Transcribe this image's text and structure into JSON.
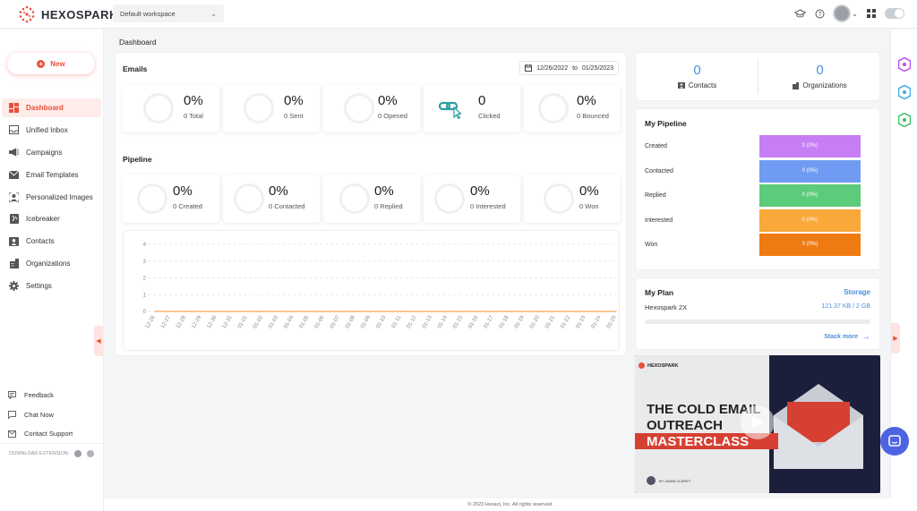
{
  "app": {
    "name": "HEXOSPARK",
    "workspace": "Default workspace"
  },
  "sidebar": {
    "new_label": "New",
    "items": [
      {
        "label": "Dashboard",
        "icon": "dashboard-icon",
        "active": true
      },
      {
        "label": "Unified Inbox",
        "icon": "inbox-icon"
      },
      {
        "label": "Campaigns",
        "icon": "megaphone-icon"
      },
      {
        "label": "Email Templates",
        "icon": "email-icon"
      },
      {
        "label": "Personalized Images",
        "icon": "image-icon"
      },
      {
        "label": "Icebreaker",
        "icon": "icebreaker-icon"
      },
      {
        "label": "Contacts",
        "icon": "contact-icon"
      },
      {
        "label": "Organizations",
        "icon": "building-icon"
      },
      {
        "label": "Settings",
        "icon": "gear-icon"
      }
    ],
    "bottom": [
      {
        "label": "Feedback",
        "icon": "feedback-icon"
      },
      {
        "label": "Chat Now",
        "icon": "chat-icon"
      },
      {
        "label": "Contact Support",
        "icon": "support-icon"
      }
    ],
    "download_label": "DOWNLOAD EXTENSION:"
  },
  "page_title": "Dashboard",
  "emails": {
    "title": "Emails",
    "date_from": "12/26/2022",
    "date_to_word": "to",
    "date_to": "01/25/2023",
    "stats": [
      {
        "value": "0%",
        "label": "0 Total"
      },
      {
        "value": "0%",
        "label": "0 Sent"
      },
      {
        "value": "0%",
        "label": "0 Opened"
      },
      {
        "value": "0",
        "label": "Clicked"
      },
      {
        "value": "0%",
        "label": "0 Bounced"
      }
    ]
  },
  "pipeline": {
    "title": "Pipeline",
    "stats": [
      {
        "value": "0%",
        "label": "0 Created"
      },
      {
        "value": "0%",
        "label": "0 Contacted"
      },
      {
        "value": "0%",
        "label": "0 Replied"
      },
      {
        "value": "0%",
        "label": "0 Interested"
      },
      {
        "value": "0%",
        "label": "0 Won"
      }
    ]
  },
  "chart_data": {
    "type": "line",
    "x": [
      "12-26",
      "12-27",
      "12-28",
      "12-29",
      "12-30",
      "12-31",
      "01-01",
      "01-02",
      "01-03",
      "01-04",
      "01-05",
      "01-06",
      "01-07",
      "01-08",
      "01-09",
      "01-10",
      "01-11",
      "01-12",
      "01-13",
      "01-14",
      "01-15",
      "01-16",
      "01-17",
      "01-18",
      "01-19",
      "01-20",
      "01-21",
      "01-22",
      "01-23",
      "01-24",
      "01-25"
    ],
    "series": [
      {
        "values": [
          0,
          0,
          0,
          0,
          0,
          0,
          0,
          0,
          0,
          0,
          0,
          0,
          0,
          0,
          0,
          0,
          0,
          0,
          0,
          0,
          0,
          0,
          0,
          0,
          0,
          0,
          0,
          0,
          0,
          0,
          0
        ]
      }
    ],
    "yticks": [
      "0",
      "1",
      "2",
      "3",
      "4"
    ],
    "ylim": [
      0,
      4
    ],
    "grid": true,
    "line_color": "#f5a34b"
  },
  "counts": {
    "contacts": {
      "value": "0",
      "label": "Contacts"
    },
    "organizations": {
      "value": "0",
      "label": "Organizations"
    }
  },
  "my_pipeline": {
    "title": "My Pipeline",
    "rows": [
      {
        "label": "Created",
        "value": "0 (0%)",
        "color": "#c77ef5"
      },
      {
        "label": "Contacted",
        "value": "0 (0%)",
        "color": "#6f9cf2"
      },
      {
        "label": "Replied",
        "value": "0 (0%)",
        "color": "#5ccb7a"
      },
      {
        "label": "Interested",
        "value": "0 (0%)",
        "color": "#f9a83a"
      },
      {
        "label": "Won",
        "value": "0 (0%)",
        "color": "#ee7b12"
      }
    ]
  },
  "plan": {
    "title": "My Plan",
    "storage_label": "Storage",
    "plan_name": "Hexospark 2X",
    "usage": "121.37 KB / 2 GB",
    "usage_fraction": 0.0001,
    "stack_more": "Stack more"
  },
  "video": {
    "brand": "HEXOSPARK",
    "line1": "THE COLD EMAIL",
    "line2": "OUTREACH",
    "line3": "MASTERCLASS",
    "byline": "BY ZAHIN CLERET"
  },
  "footer": "© 2023 Hexact, Inc. All rights reserved.",
  "colors": {
    "brand": "#e8513b",
    "accent": "#4a8fe0"
  }
}
